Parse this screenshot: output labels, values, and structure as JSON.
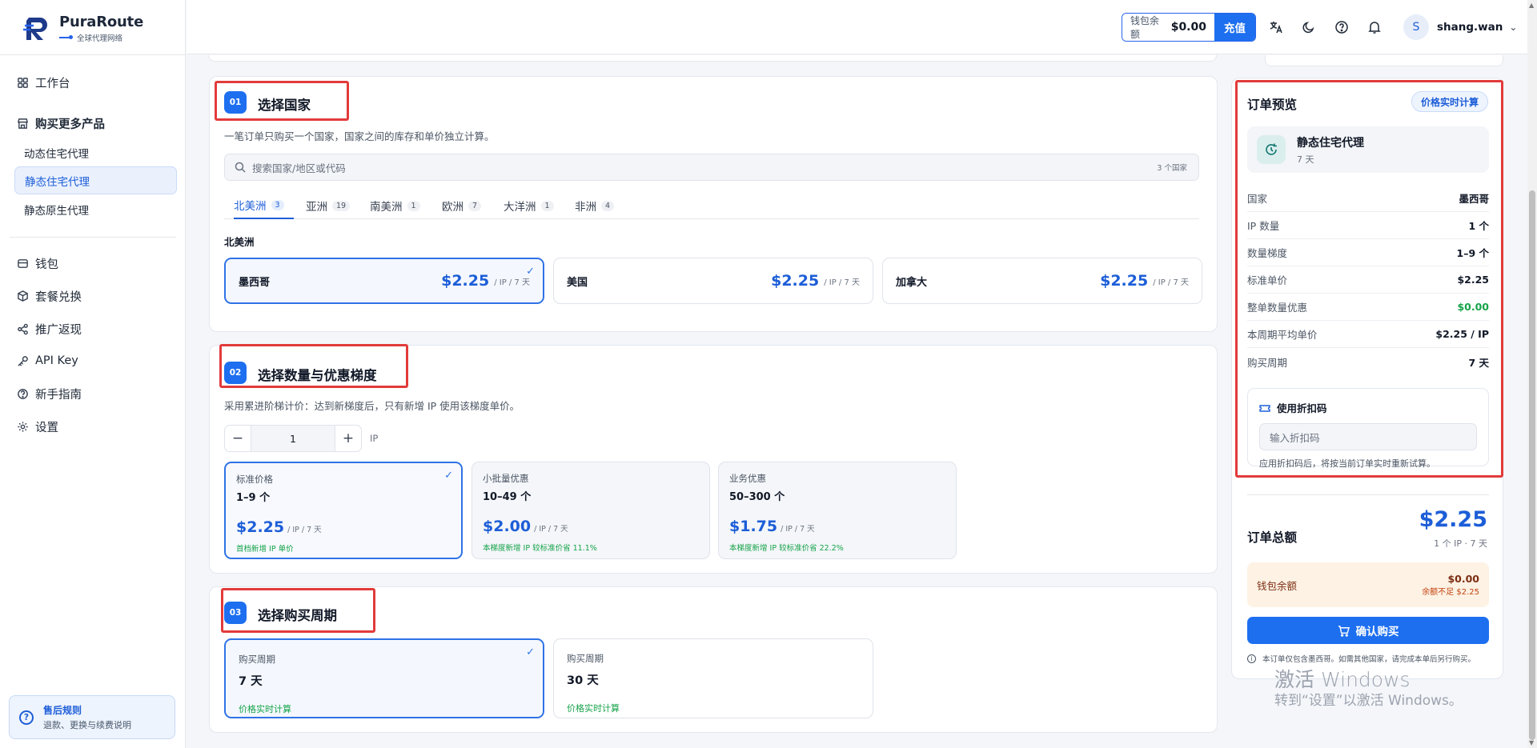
{
  "app": {
    "name": "PuraRoute",
    "tagline": "全球代理网络"
  },
  "topbar": {
    "wallet_label": "钱包余额",
    "wallet_amount": "$0.00",
    "recharge_label": "充值",
    "icons": [
      "translate-icon",
      "moon-icon",
      "help-icon",
      "bell-icon"
    ],
    "user_initial": "S",
    "user_name": "shang.wan"
  },
  "sidebar": {
    "workbench": "工作台",
    "buy_more": "购买更多产品",
    "products": [
      "动态住宅代理",
      "静态住宅代理",
      "静态原生代理"
    ],
    "active_product": "静态住宅代理",
    "items": [
      "钱包",
      "套餐兑换",
      "推广返现",
      "API Key",
      "新手指南",
      "设置"
    ],
    "help_title": "售后规则",
    "help_sub": "退款、更换与续费说明"
  },
  "step1": {
    "badge": "01",
    "title": "选择国家",
    "desc": "一笔订单只购买一个国家，国家之间的库存和单价独立计算。",
    "search_placeholder": "搜索国家/地区或代码",
    "search_count": "3 个国家",
    "tabs": [
      {
        "label": "北美洲",
        "count": "3"
      },
      {
        "label": "亚洲",
        "count": "19"
      },
      {
        "label": "南美洲",
        "count": "1"
      },
      {
        "label": "欧洲",
        "count": "7"
      },
      {
        "label": "大洋洲",
        "count": "1"
      },
      {
        "label": "非洲",
        "count": "4"
      }
    ],
    "region": "北美洲",
    "countries": [
      {
        "name": "墨西哥",
        "price": "$2.25",
        "unit": "/ IP / 7 天"
      },
      {
        "name": "美国",
        "price": "$2.25",
        "unit": "/ IP / 7 天"
      },
      {
        "name": "加拿大",
        "price": "$2.25",
        "unit": "/ IP / 7 天"
      }
    ]
  },
  "step2": {
    "badge": "02",
    "title": "选择数量与优惠梯度",
    "desc": "采用累进阶梯计价：达到新梯度后，只有新增 IP 使用该梯度单价。",
    "quantity": "1",
    "quantity_unit": "IP",
    "tiers": [
      {
        "name": "标准价格",
        "range": "1–9 个",
        "price": "$2.25",
        "unit": "/ IP / 7 天",
        "note": "首档新增 IP 单价"
      },
      {
        "name": "小批量优惠",
        "range": "10–49 个",
        "price": "$2.00",
        "unit": "/ IP / 7 天",
        "note": "本梯度新增 IP 较标准价省 11.1%"
      },
      {
        "name": "业务优惠",
        "range": "50–300 个",
        "price": "$1.75",
        "unit": "/ IP / 7 天",
        "note": "本梯度新增 IP 较标准价省 22.2%"
      }
    ]
  },
  "step3": {
    "badge": "03",
    "title": "选择购买周期",
    "periods": [
      {
        "label": "购买周期",
        "value": "7 天",
        "note": "价格实时计算"
      },
      {
        "label": "购买周期",
        "value": "30 天",
        "note": "价格实时计算"
      }
    ]
  },
  "order": {
    "title": "订单预览",
    "live_badge": "价格实时计算",
    "product": "静态住宅代理",
    "product_days": "7 天",
    "rows": [
      {
        "k": "国家",
        "v": "墨西哥"
      },
      {
        "k": "IP 数量",
        "v": "1 个"
      },
      {
        "k": "数量梯度",
        "v": "1–9 个"
      },
      {
        "k": "标准单价",
        "v": "$2.25"
      },
      {
        "k": "整单数量优惠",
        "v": "$0.00"
      },
      {
        "k": "本周期平均单价",
        "v": "$2.25 / IP"
      },
      {
        "k": "购买周期",
        "v": "7 天"
      }
    ],
    "discount_title": "使用折扣码",
    "discount_placeholder": "输入折扣码",
    "discount_hint": "应用折扣码后，将按当前订单实时重新试算。",
    "total_label": "订单总额",
    "total_price": "$2.25",
    "total_sub": "1 个 IP · 7 天",
    "wallet_label": "钱包余额",
    "wallet_amount": "$0.00",
    "wallet_short": "余额不足 $2.25",
    "buy_label": "确认购买",
    "note": "本订单仅包含墨西哥。如需其他国家，请完成本单后另行购买。"
  },
  "colors": {
    "accent": "#1d6ff0",
    "annotation": "#e23b3b",
    "success": "#16a34a"
  },
  "watermark": {
    "line1": "激活 Windows",
    "line2": "转到“设置”以激活 Windows。"
  }
}
